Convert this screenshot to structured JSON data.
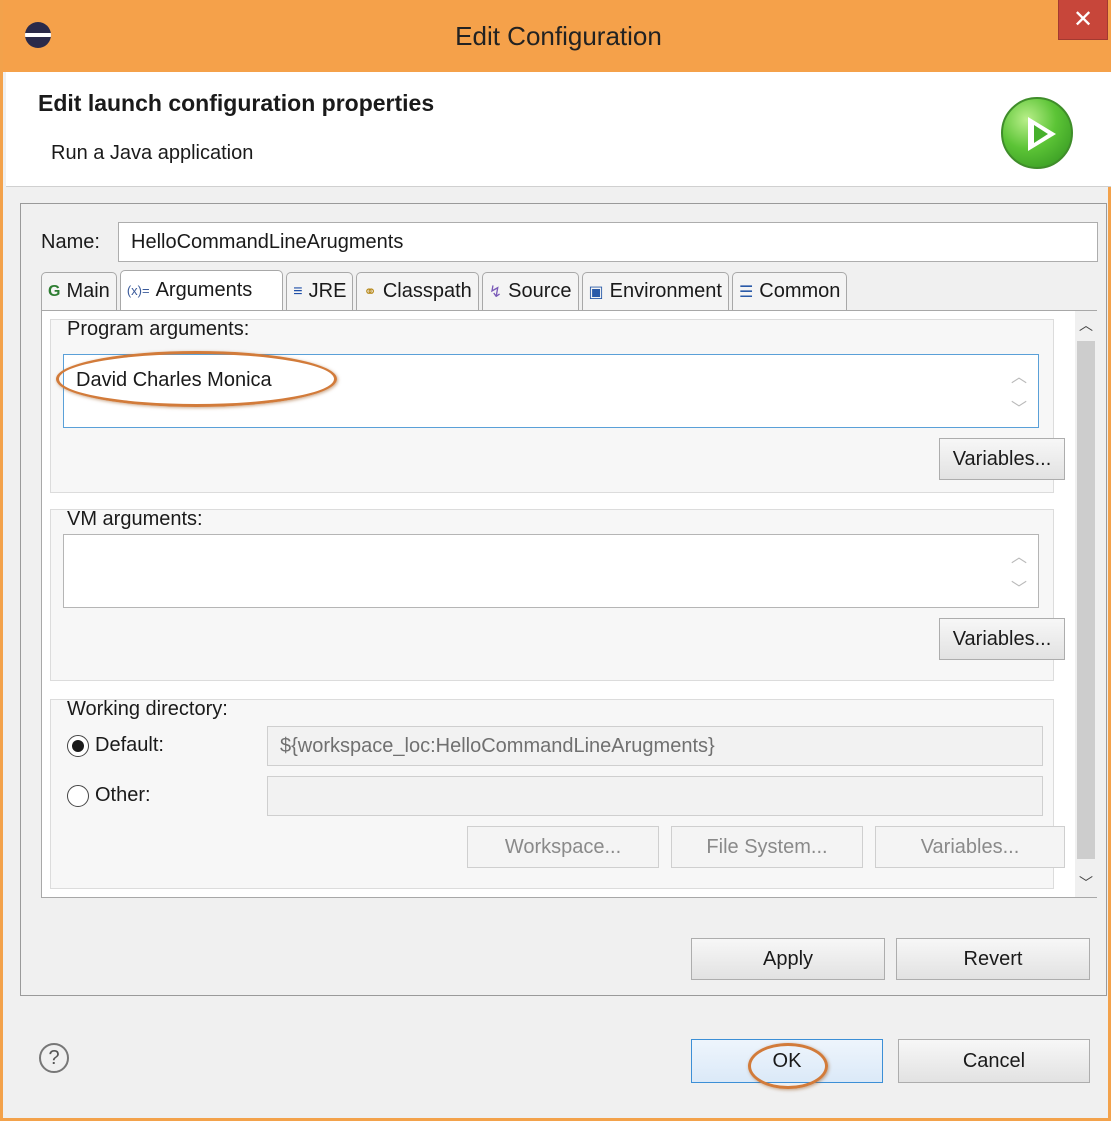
{
  "window": {
    "title": "Edit Configuration",
    "close_glyph": "✕"
  },
  "header": {
    "title": "Edit launch configuration properties",
    "subtitle": "Run a Java application"
  },
  "name": {
    "label": "Name:",
    "value": "HelloCommandLineArugments"
  },
  "tabs": [
    {
      "label": "Main",
      "icon": "main-icon",
      "glyph": "G"
    },
    {
      "label": "Arguments",
      "icon": "arguments-icon",
      "glyph": "(x)="
    },
    {
      "label": "JRE",
      "icon": "jre-icon",
      "glyph": "≡"
    },
    {
      "label": "Classpath",
      "icon": "classpath-icon",
      "glyph": "⚭"
    },
    {
      "label": "Source",
      "icon": "source-icon",
      "glyph": "↯"
    },
    {
      "label": "Environment",
      "icon": "environment-icon",
      "glyph": "▣"
    },
    {
      "label": "Common",
      "icon": "common-icon",
      "glyph": "☰"
    }
  ],
  "active_tab": "Arguments",
  "program_args": {
    "label": "Program arguments:",
    "value": "David Charles Monica",
    "variables_button": "Variables..."
  },
  "vm_args": {
    "label": "VM arguments:",
    "value": "",
    "variables_button": "Variables..."
  },
  "working_dir": {
    "label": "Working directory:",
    "default_label": "Default:",
    "default_value": "${workspace_loc:HelloCommandLineArugments}",
    "other_label": "Other:",
    "other_value": "",
    "selected": "Default",
    "workspace_button": "Workspace...",
    "filesystem_button": "File System...",
    "variables_button": "Variables..."
  },
  "apply_button": "Apply",
  "revert_button": "Revert",
  "ok_button": "OK",
  "cancel_button": "Cancel",
  "help_glyph": "?",
  "colors": {
    "titlebar": "#f5a14a",
    "close": "#c7463a",
    "highlight": "#d27b3a",
    "focus": "#5aa0d8"
  }
}
